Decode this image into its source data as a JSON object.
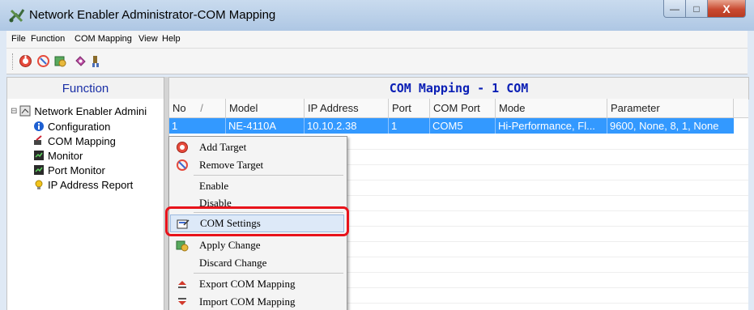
{
  "window": {
    "title": "Network Enabler Administrator-COM Mapping",
    "caption": {
      "min": "—",
      "max": "□",
      "close": "X"
    }
  },
  "menu": {
    "file": "File",
    "function": "Function",
    "com_mapping": "COM Mapping",
    "view": "View",
    "help": "Help"
  },
  "toolbar": {
    "icons": [
      "add-target-icon",
      "remove-target-icon",
      "apply-change-icon",
      "settings-icon",
      "search-icon"
    ]
  },
  "left_panel": {
    "header": "Function",
    "tree": {
      "root": "Network Enabler Admini",
      "items": [
        "Configuration",
        "COM Mapping",
        "Monitor",
        "Port Monitor",
        "IP Address Report"
      ]
    }
  },
  "right_panel": {
    "header": "COM Mapping - 1 COM",
    "columns": [
      "No",
      "/",
      "Model",
      "IP Address",
      "Port",
      "COM Port",
      "Mode",
      "Parameter"
    ],
    "rows": [
      {
        "no": "1",
        "model": "NE-4110A",
        "ip": "10.10.2.38",
        "port": "1",
        "com_port": "COM5",
        "mode": "Hi-Performance, Fl...",
        "parameter": "9600, None, 8, 1, None"
      }
    ]
  },
  "context_menu": {
    "add_target": "Add Target",
    "remove_target": "Remove Target",
    "enable": "Enable",
    "disable": "Disable",
    "com_settings": "COM Settings",
    "apply_change": "Apply Change",
    "discard_change": "Discard Change",
    "export": "Export COM Mapping",
    "import": "Import COM Mapping"
  },
  "colors": {
    "selection": "#3399ff",
    "highlight_box": "#e8131b",
    "header_text": "#0a1fb5"
  }
}
